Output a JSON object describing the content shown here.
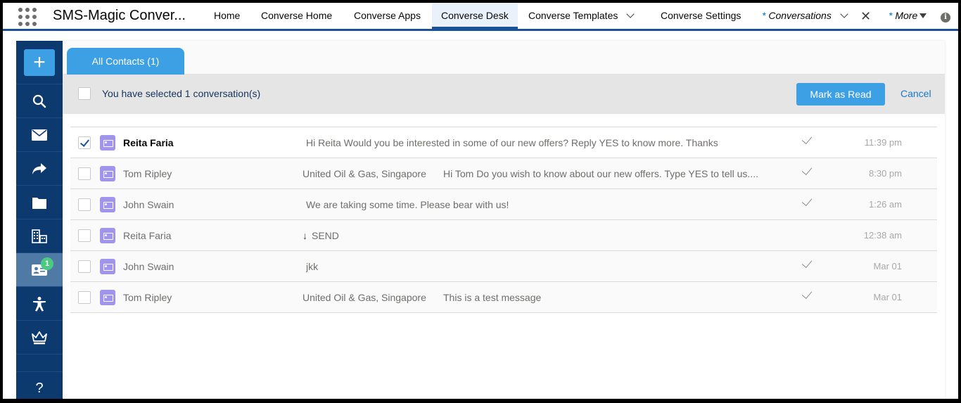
{
  "app": {
    "name": "SMS-Magic Conver..."
  },
  "nav": {
    "items": [
      {
        "label": "Home"
      },
      {
        "label": "Converse Home"
      },
      {
        "label": "Converse Apps"
      },
      {
        "label": "Converse Desk"
      },
      {
        "label": "Converse Templates"
      },
      {
        "label": "Converse Settings"
      },
      {
        "label": "Conversations",
        "prefix": "* "
      },
      {
        "label": "More",
        "prefix": "* "
      }
    ],
    "active": "Converse Desk",
    "info_icon": "i"
  },
  "sidebar": {
    "new_label": "+",
    "items": [
      {
        "icon": "search-icon"
      },
      {
        "icon": "envelope-icon"
      },
      {
        "icon": "share-arrow-icon"
      },
      {
        "icon": "folder-icon"
      },
      {
        "icon": "building-icon"
      },
      {
        "icon": "contact-card-icon",
        "badge": "1",
        "active": true
      },
      {
        "icon": "accessibility-icon"
      },
      {
        "icon": "crown-icon"
      },
      {
        "icon": "help-icon"
      }
    ]
  },
  "tabs": {
    "all_contacts": "All Contacts (1)"
  },
  "selection": {
    "text": "You have selected 1 conversation(s)",
    "mark_read": "Mark as Read",
    "cancel": "Cancel"
  },
  "conversations": [
    {
      "name": "Reita Faria",
      "company": "",
      "message": "Hi Reita Would you be interested in some of our new offers? Reply YES to know more. Thanks",
      "time": "11:39 pm",
      "checked": true,
      "read": true
    },
    {
      "name": "Tom Ripley",
      "company": "United Oil & Gas, Singapore",
      "message": "Hi Tom Do you wish to know about our new offers. Type YES to tell us....",
      "time": "8:30 pm",
      "checked": false,
      "read": true
    },
    {
      "name": "John Swain",
      "company": "",
      "message": "We are taking some time. Please bear with us!",
      "time": "1:26 am",
      "checked": false,
      "read": true
    },
    {
      "name": "Reita Faria",
      "company": "",
      "message": "SEND",
      "time": "12:38 am",
      "checked": false,
      "read": false,
      "inbound": true
    },
    {
      "name": "John Swain",
      "company": "",
      "message": "jkk",
      "time": "Mar 01",
      "checked": false,
      "read": true
    },
    {
      "name": "Tom Ripley",
      "company": "United Oil & Gas, Singapore",
      "message": "This is a test message",
      "time": "Mar 01",
      "checked": false,
      "read": true
    }
  ],
  "colors": {
    "brand": "#1b5297",
    "accent": "#3ea0e4",
    "sidebar": "#0d3a6e",
    "badge": "#4bca81",
    "contact_icon": "#a094ed"
  }
}
